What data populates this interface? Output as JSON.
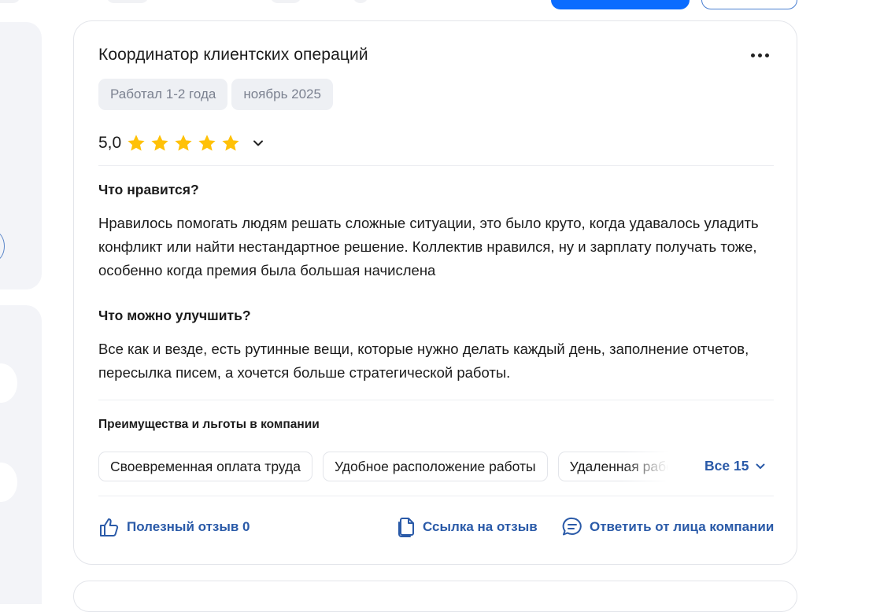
{
  "review": {
    "title": "Координатор клиентских операций",
    "tags": [
      "Работал 1-2 года",
      "ноябрь 2025"
    ],
    "rating": "5,0",
    "stars": 5,
    "pros_heading": "Что нравится?",
    "pros_text": "Нравилось помогать людям решать сложные ситуации, это было круто, когда удавалось уладить конфликт или найти нестандартное решение. Коллектив нравился, ну и зарплату получать тоже, особенно когда премия была большая начислена",
    "cons_heading": "Что можно улучшить?",
    "cons_text": "Все как и везде, есть рутинные вещи, которые нужно делать каждый день, заполнение отчетов, пересылка писем, а хочется больше стратегической работы.",
    "benefits_heading": "Преимущества и льготы в компании",
    "benefits": [
      "Своевременная оплата труда",
      "Удобное расположение работы",
      "Удаленная работа"
    ],
    "benefits_all": "Все 15",
    "actions": {
      "helpful": "Полезный отзыв 0",
      "link": "Ссылка на отзыв",
      "reply": "Ответить от лица компании"
    }
  },
  "colors": {
    "accent": "#2a5aa8",
    "star": "#ffc107",
    "tag_bg": "#eef0f4",
    "primary_button": "#0a6cff"
  },
  "icons": {
    "more": "more-dots-icon",
    "expand": "chevron-down-icon",
    "helpful": "thumbs-up-icon",
    "link": "copy-link-icon",
    "reply": "chat-bubble-icon"
  }
}
